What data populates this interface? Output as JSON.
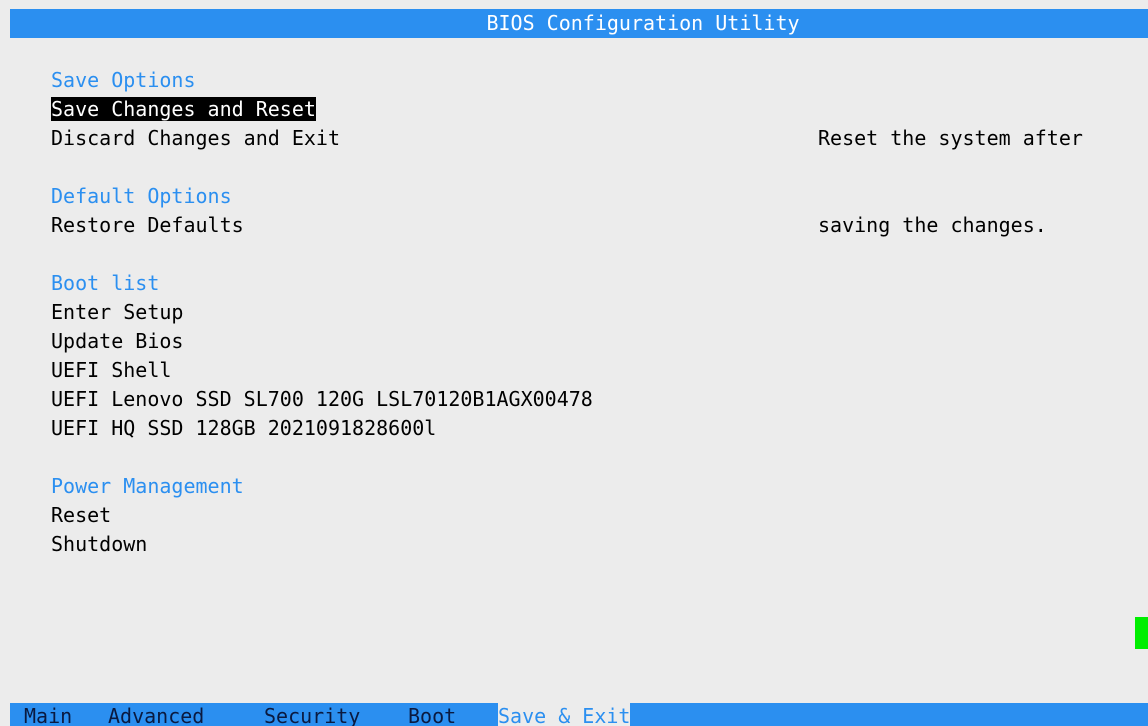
{
  "title": "BIOS Configuration Utility",
  "sections": [
    {
      "title": "Save Options",
      "items": [
        {
          "label": "Save Changes and Reset",
          "selected": true
        },
        {
          "label": "Discard Changes and Exit",
          "selected": false
        }
      ]
    },
    {
      "title": "Default Options",
      "items": [
        {
          "label": "Restore Defaults",
          "selected": false
        }
      ]
    },
    {
      "title": "Boot list",
      "items": [
        {
          "label": "Enter Setup",
          "selected": false
        },
        {
          "label": "Update Bios",
          "selected": false
        },
        {
          "label": "UEFI Shell",
          "selected": false
        },
        {
          "label": "UEFI Lenovo SSD SL700 120G LSL70120B1AGX00478",
          "selected": false
        },
        {
          "label": "UEFI HQ SSD 128GB 2021091828600l",
          "selected": false
        }
      ]
    },
    {
      "title": "Power Management",
      "items": [
        {
          "label": "Reset",
          "selected": false
        },
        {
          "label": "Shutdown",
          "selected": false
        }
      ]
    }
  ],
  "help": {
    "line1": "Reset the system after",
    "line2": "saving the changes."
  },
  "tabs": [
    {
      "label": "Main",
      "active": false
    },
    {
      "label": "Advanced",
      "active": false
    },
    {
      "label": "Security",
      "active": false
    },
    {
      "label": "Boot",
      "active": false
    },
    {
      "label": "Save & Exit",
      "active": true
    }
  ],
  "colors": {
    "accent": "#2b8ff0",
    "background": "#ececec",
    "selection_bg": "#000000",
    "cursor": "#00ee00"
  }
}
